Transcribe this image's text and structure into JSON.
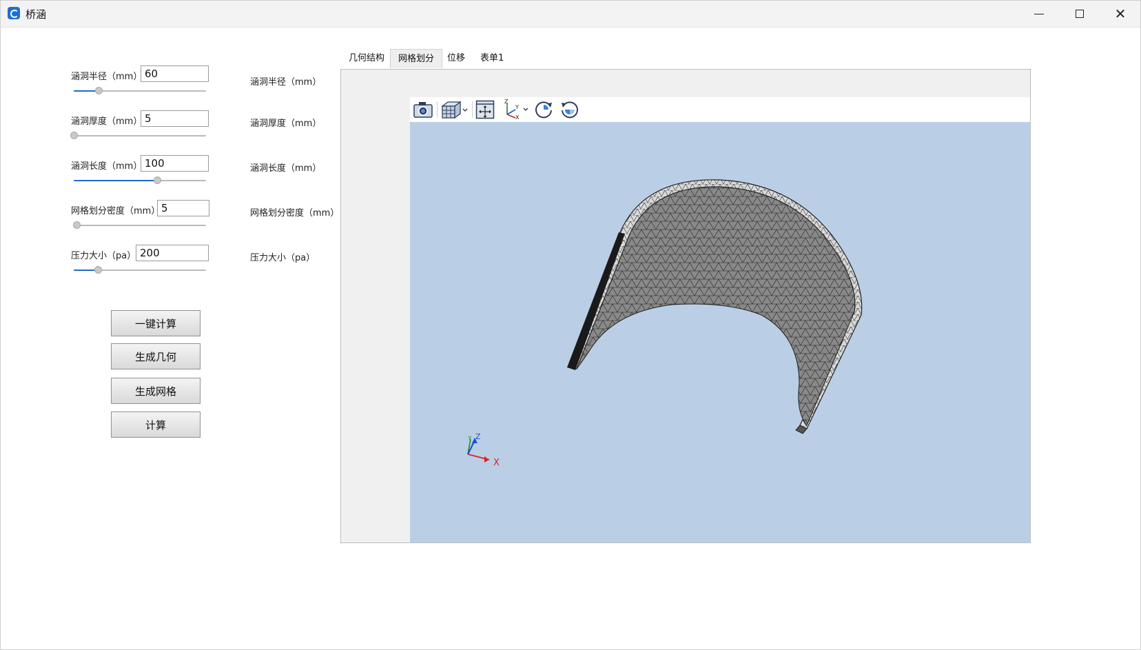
{
  "window": {
    "title": "桥涵",
    "minimize_icon": "minimize-icon",
    "maximize_icon": "maximize-icon",
    "close_icon": "close-icon"
  },
  "params": [
    {
      "label": "涵洞半径（mm）",
      "value": "60",
      "slider_fraction": 0.19,
      "echo_label": "涵洞半径（mm）"
    },
    {
      "label": "涵洞厚度（mm）",
      "value": "5",
      "slider_fraction": 0.0,
      "echo_label": "涵洞厚度（mm）"
    },
    {
      "label": "涵洞长度（mm）",
      "value": "100",
      "slider_fraction": 0.63,
      "echo_label": "涵洞长度（mm）"
    },
    {
      "label": "网格划分密度（mm）",
      "value": "5",
      "slider_fraction": 0.02,
      "echo_label": "网格划分密度（mm）"
    },
    {
      "label": "压力大小（pa）",
      "value": "200",
      "slider_fraction": 0.18,
      "echo_label": "压力大小（pa）"
    }
  ],
  "buttons": {
    "one_click": "一键计算",
    "gen_geometry": "生成几何",
    "gen_mesh": "生成网格",
    "compute": "计算"
  },
  "tabs": [
    {
      "label": "几何结构",
      "active": false
    },
    {
      "label": "网格划分",
      "active": true
    },
    {
      "label": "位移",
      "active": false
    },
    {
      "label": "表单1",
      "active": false
    }
  ],
  "viewer": {
    "toolbar_icons": [
      "camera-icon",
      "cube-view-icon",
      "fit-view-icon",
      "axes-orientation-icon",
      "rotate-cw-icon",
      "rotate-ccw-icon"
    ],
    "axis_labels": {
      "x": "X",
      "z": "Z",
      "y": "Y"
    },
    "background": "#bacfe6",
    "mesh_color": "#a9a9a9"
  },
  "colors": {
    "slider_fill": "#1e6ac9",
    "title_bar": "#f3f3f3"
  }
}
